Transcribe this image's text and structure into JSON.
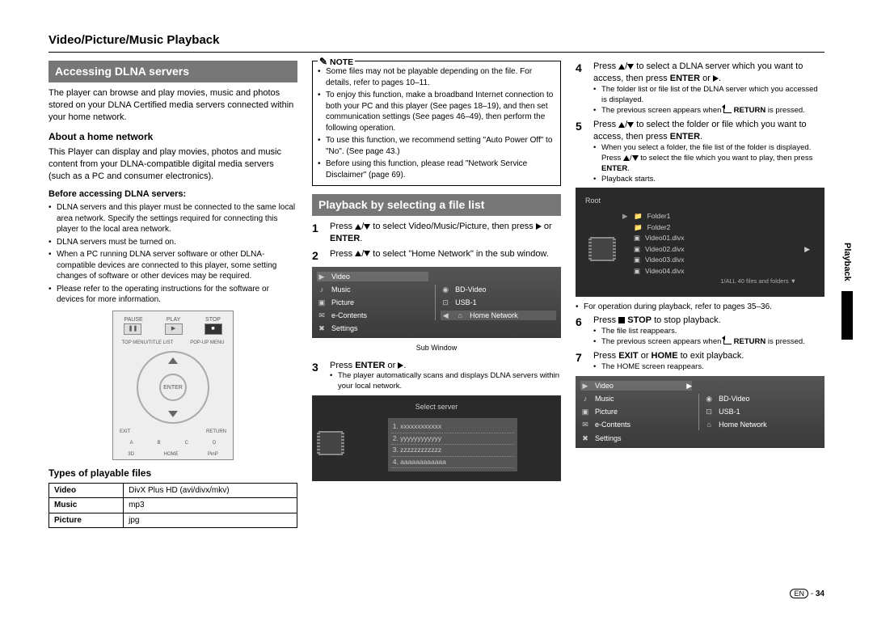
{
  "header": {
    "title": "Video/Picture/Music Playback"
  },
  "col1": {
    "block": "Accessing DLNA servers",
    "intro": "The player can browse and play movies, music and photos stored on your DLNA Certified media servers connected within your home network.",
    "about_h": "About a home network",
    "about_p": "This Player can display and play movies, photos and music content from your DLNA-compatible digital media servers (such as a PC and consumer electronics).",
    "before_h": "Before accessing DLNA servers:",
    "before": [
      "DLNA servers and this player must be connected to the same local area network. Specify the settings required for connecting this player to the local area network.",
      "DLNA servers must be turned on.",
      "When a PC running DLNA server software or other DLNA-compatible devices are connected to this player, some setting changes of software or other devices may be required.",
      "Please refer to the operating instructions for the software or devices for more information."
    ],
    "remote": {
      "pause": "PAUSE",
      "play": "PLAY",
      "stop": "STOP",
      "enter": "ENTER",
      "topmenu": "TOP MENU/TITLE LIST",
      "popup": "POP-UP MENU",
      "exit": "EXIT",
      "return": "RETURN",
      "home": "HOME"
    },
    "types_h": "Types of playable files",
    "types": [
      [
        "Video",
        "DivX Plus HD (avi/divx/mkv)"
      ],
      [
        "Music",
        "mp3"
      ],
      [
        "Picture",
        "jpg"
      ]
    ]
  },
  "col2": {
    "note_title": "NOTE",
    "notes": [
      "Some files may not be playable depending on the file. For details, refer to pages 10–11.",
      "To enjoy this function, make a broadband Internet connection to both your PC and this player (See pages 18–19), and then set communication settings (See pages 46–49), then perform the following operation.",
      "To use this function, we recommend setting \"Auto Power Off\" to \"No\". (See page 43.)",
      "Before using this function, please read \"Network Service Disclaimer\" (page 69)."
    ],
    "block": "Playback by selecting a file list",
    "step1": "Press ▲/▼ to select Video/Music/Picture, then press ▶ or ENTER.",
    "step2": "Press ▲/▼ to select \"Home Network\" in the sub window.",
    "menu_left": [
      "Video",
      "Music",
      "Picture",
      "e-Contents",
      "Settings"
    ],
    "menu_right": [
      "BD-Video",
      "USB-1",
      "Home Network"
    ],
    "subwindow": "Sub Window",
    "step3": "Press ENTER or ▶.",
    "step3_sub": "The player automatically scans and displays DLNA servers within your local network.",
    "selectserver": "Select server",
    "servers": [
      "1. xxxxxxxxxxxx",
      "2. yyyyyyyyyyyy",
      "3. zzzzzzzzzzzz",
      "4. aaaaaaaaaaaa"
    ]
  },
  "col3": {
    "step4": "Press ▲/▼ to select a DLNA server which you want to access, then press ENTER or ▶.",
    "step4_subs": [
      "The folder list or file list of the DLNA server which you accessed is displayed.",
      "The previous screen appears when ↩ RETURN is pressed."
    ],
    "step5": "Press ▲/▼ to select the folder or file which you want to access, then press ENTER.",
    "step5_subs": [
      "When you select a folder, the file list of the folder is displayed. Press ▲/▼ to select the file which you want to play, then press ENTER.",
      "Playback starts."
    ],
    "root": "Root",
    "files": [
      "Folder1",
      "Folder2",
      "Video01.divx",
      "Video02.divx",
      "Video03.divx",
      "Video04.divx"
    ],
    "file_count": "1/ALL  40 files and folders  ▼",
    "after_root": "For operation during playback, refer to pages 35–36.",
    "step6": "Press ■ STOP to stop playback.",
    "step6_subs": [
      "The file list reappears.",
      "The previous screen appears when ↩ RETURN is pressed."
    ],
    "step7": "Press EXIT or HOME to exit playback.",
    "step7_sub": "The HOME screen reappears.",
    "menu_left": [
      "Video",
      "Music",
      "Picture",
      "e-Contents",
      "Settings"
    ],
    "menu_right": [
      "BD-Video",
      "USB-1",
      "Home Network"
    ]
  },
  "side": "Playback",
  "footer": {
    "lang": "EN",
    "page": "34"
  }
}
